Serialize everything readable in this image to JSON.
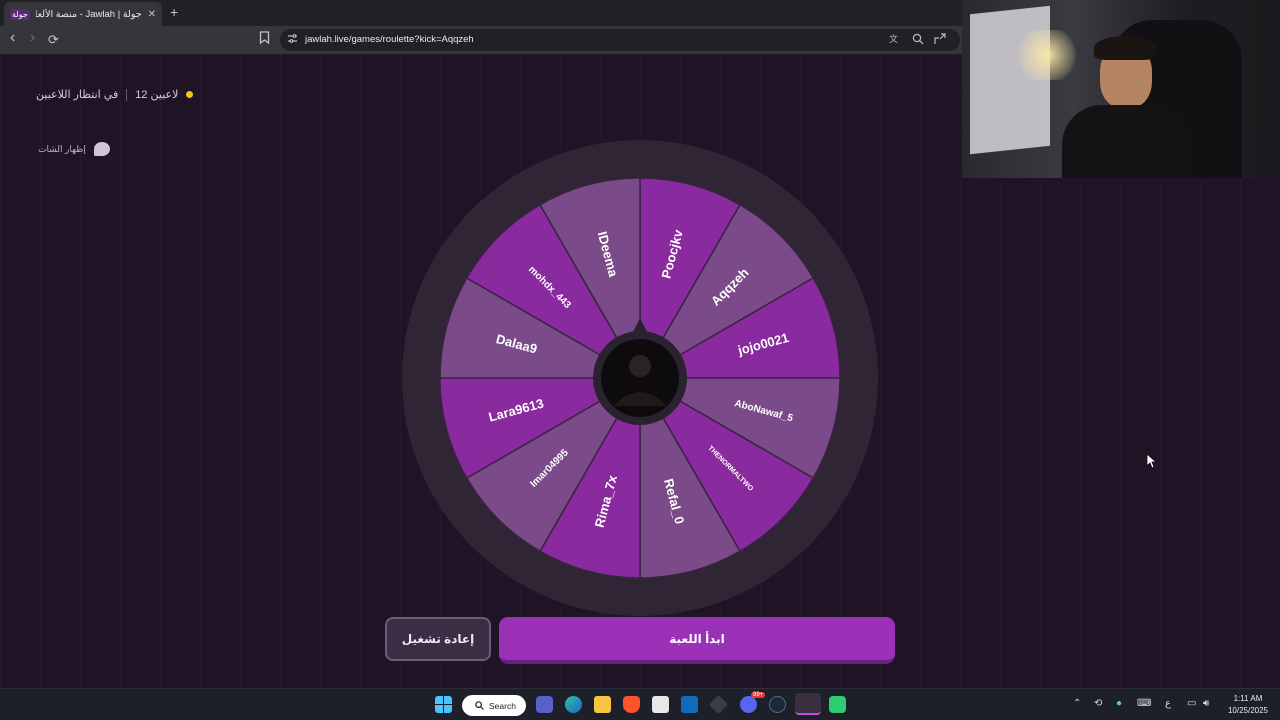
{
  "browser": {
    "tab_title": "جولة | Jawlah - منصة الألعاب التفاعلية",
    "tab_favicon": "جولة",
    "new_tab": "+",
    "url": "jawlah.live/games/roulette?kick=Aqqzeh",
    "back_icon": "‹",
    "forward_icon": "›",
    "reload_icon": "⟳",
    "close_icon": "✕"
  },
  "status": {
    "player_count": "12 لاعبين",
    "waiting": "في انتظار اللاعبين",
    "dot_color": "#f5c518"
  },
  "chat": {
    "label": "إظهار الشات"
  },
  "wheel": {
    "segments": [
      "Poocjkv",
      "Aqqzeh",
      "jojo0021",
      "AboNawaf_5",
      "THENORMALTWO",
      "Refal_0",
      "Rima_7x",
      "Imar04995",
      "Lara9613",
      "Dalaa9",
      "mohdx_443",
      "IDeema"
    ],
    "colors": [
      "#8a2a9f",
      "#7b4a88"
    ]
  },
  "buttons": {
    "restart": "إعادة تشغيل",
    "start": "ابدأ اللعبة"
  },
  "taskbar": {
    "search": "Search",
    "lang": "ع",
    "time": "1:11 AM",
    "date": "10/25/2025",
    "badge": "99+"
  }
}
